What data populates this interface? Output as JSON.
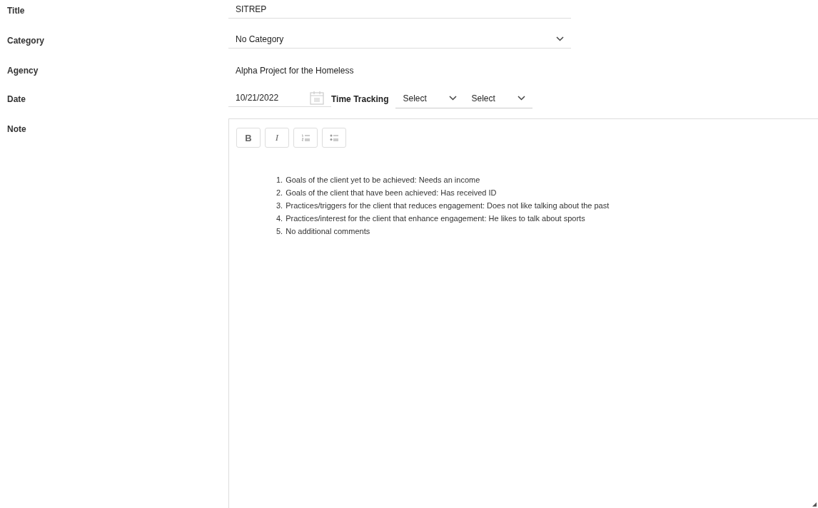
{
  "title": {
    "label": "Title",
    "value": "SITREP"
  },
  "category": {
    "label": "Category",
    "value": "No Category"
  },
  "agency": {
    "label": "Agency",
    "value": "Alpha Project for the Homeless"
  },
  "date": {
    "label": "Date",
    "value": "10/21/2022",
    "time_tracking_label": "Time Tracking",
    "selects": [
      "Select",
      "Select"
    ]
  },
  "note": {
    "label": "Note",
    "toolbar": [
      {
        "kind": "bold",
        "label": "B"
      },
      {
        "kind": "italic",
        "label": "I"
      },
      {
        "kind": "ordered-list"
      },
      {
        "kind": "bullet-list"
      }
    ],
    "items": [
      {
        "number": "1.",
        "text": "Goals of the client yet to be achieved: Needs an income"
      },
      {
        "number": "2.",
        "text": "Goals of the client that have been achieved: Has received ID"
      },
      {
        "number": "3.",
        "text": "Practices/triggers for the client that reduces engagement: Does not like talking about the past"
      },
      {
        "number": "4.",
        "text": "Practices/interest for the client that enhance engagement: He likes to talk about sports"
      },
      {
        "number": "5.",
        "text": "No additional comments"
      }
    ]
  }
}
